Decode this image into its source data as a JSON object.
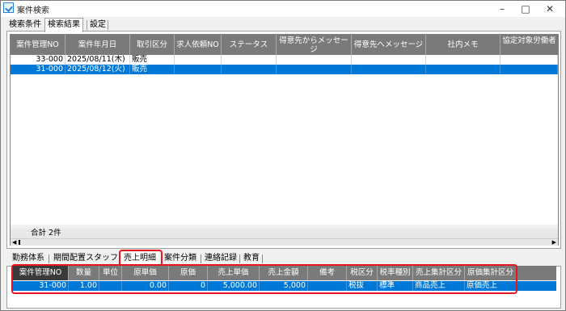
{
  "window": {
    "title": "案件検索"
  },
  "top_tabs": [
    "検索条件",
    "検索結果",
    "設定"
  ],
  "results_grid": {
    "columns": [
      "案件管理NO",
      "案件年月日",
      "取引区分",
      "求人依頼NO",
      "ステータス",
      "得意先からメッセージ",
      "得意先へメッセージ",
      "社内メモ",
      "協定対象労働者"
    ],
    "rows": [
      [
        "33-000",
        "2025/08/11(木)",
        "販売",
        "",
        "",
        "",
        "",
        "",
        ""
      ],
      [
        "31-000",
        "2025/08/12(火)",
        "販売",
        "",
        "",
        "",
        "",
        "",
        ""
      ]
    ],
    "total_label": "合計 2件"
  },
  "bottom_tabs": [
    "勤務体系",
    "期間配置スタッフ",
    "売上明細",
    "案件分類",
    "連絡記録",
    "教育"
  ],
  "detail_grid": {
    "columns": [
      "案件管理NO",
      "数量",
      "単位",
      "原単価",
      "原価",
      "売上単価",
      "売上金額",
      "備考",
      "税区分",
      "税率種別",
      "売上集計区分",
      "原価集計区分"
    ],
    "row": [
      "31-000",
      "1.00",
      "",
      "0.00",
      "0",
      "5,000.00",
      "5,000",
      "",
      "税抜",
      "標準",
      "商品売上",
      "原価売上"
    ]
  },
  "colors": {
    "highlight": "#e8141e",
    "selection": "#0078d7",
    "header": "#7a7a7a"
  }
}
